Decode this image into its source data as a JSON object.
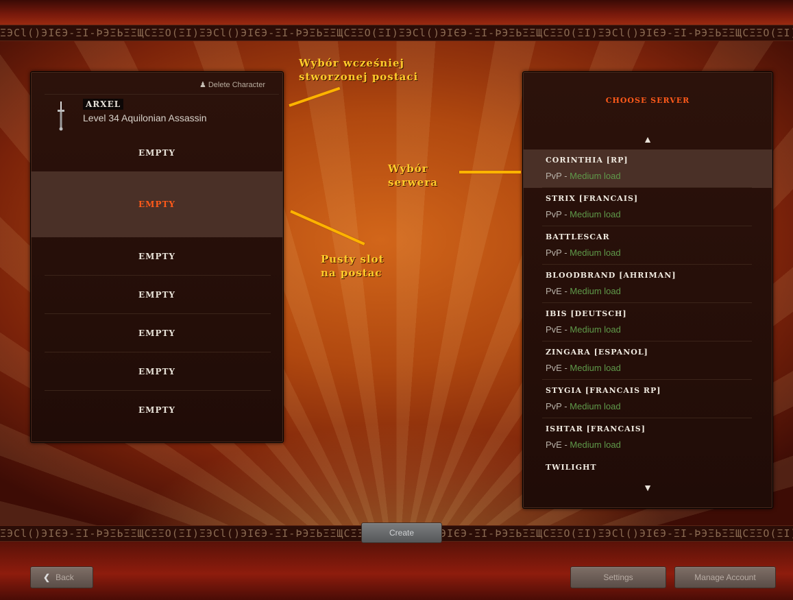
{
  "annotations": {
    "select_character_line1": "Wybór wcześniej",
    "select_character_line2": "stworzonej postaci",
    "select_server_line1": "Wybór",
    "select_server_line2": "serwera",
    "empty_slot_line1": "Pusty slot",
    "empty_slot_line2": "na postac"
  },
  "characters": {
    "delete_label": "Delete Character",
    "first": {
      "name": "ARXEL",
      "description": "Level 34 Aquilonian Assassin"
    },
    "empty_label": "EMPTY"
  },
  "servers": {
    "title": "CHOOSE SERVER",
    "list": [
      {
        "name": "CORINTHIA [RP]",
        "type": "PvP - ",
        "load": "Medium load"
      },
      {
        "name": "STRIX [FRANCAIS]",
        "type": "PvP - ",
        "load": "Medium load"
      },
      {
        "name": "BATTLESCAR",
        "type": "PvP - ",
        "load": "Medium load"
      },
      {
        "name": "BLOODBRAND [AHRIMAN]",
        "type": "PvE - ",
        "load": "Medium load"
      },
      {
        "name": "IBIS [DEUTSCH]",
        "type": "PvE - ",
        "load": "Medium load"
      },
      {
        "name": "ZINGARA [ESPANOL]",
        "type": "PvE - ",
        "load": "Medium load"
      },
      {
        "name": "STYGIA [FRANCAIS RP]",
        "type": "PvP - ",
        "load": "Medium load"
      },
      {
        "name": "ISHTAR [FRANCAIS]",
        "type": "PvE - ",
        "load": "Medium load"
      }
    ],
    "partial": "TWILIGHT"
  },
  "buttons": {
    "create": "Create",
    "back": "Back",
    "settings": "Settings",
    "manage": "Manage Account"
  },
  "colors": {
    "accent": "#ff5a1a",
    "annotation": "#ffcb2a",
    "load": "#5f9a4a"
  }
}
